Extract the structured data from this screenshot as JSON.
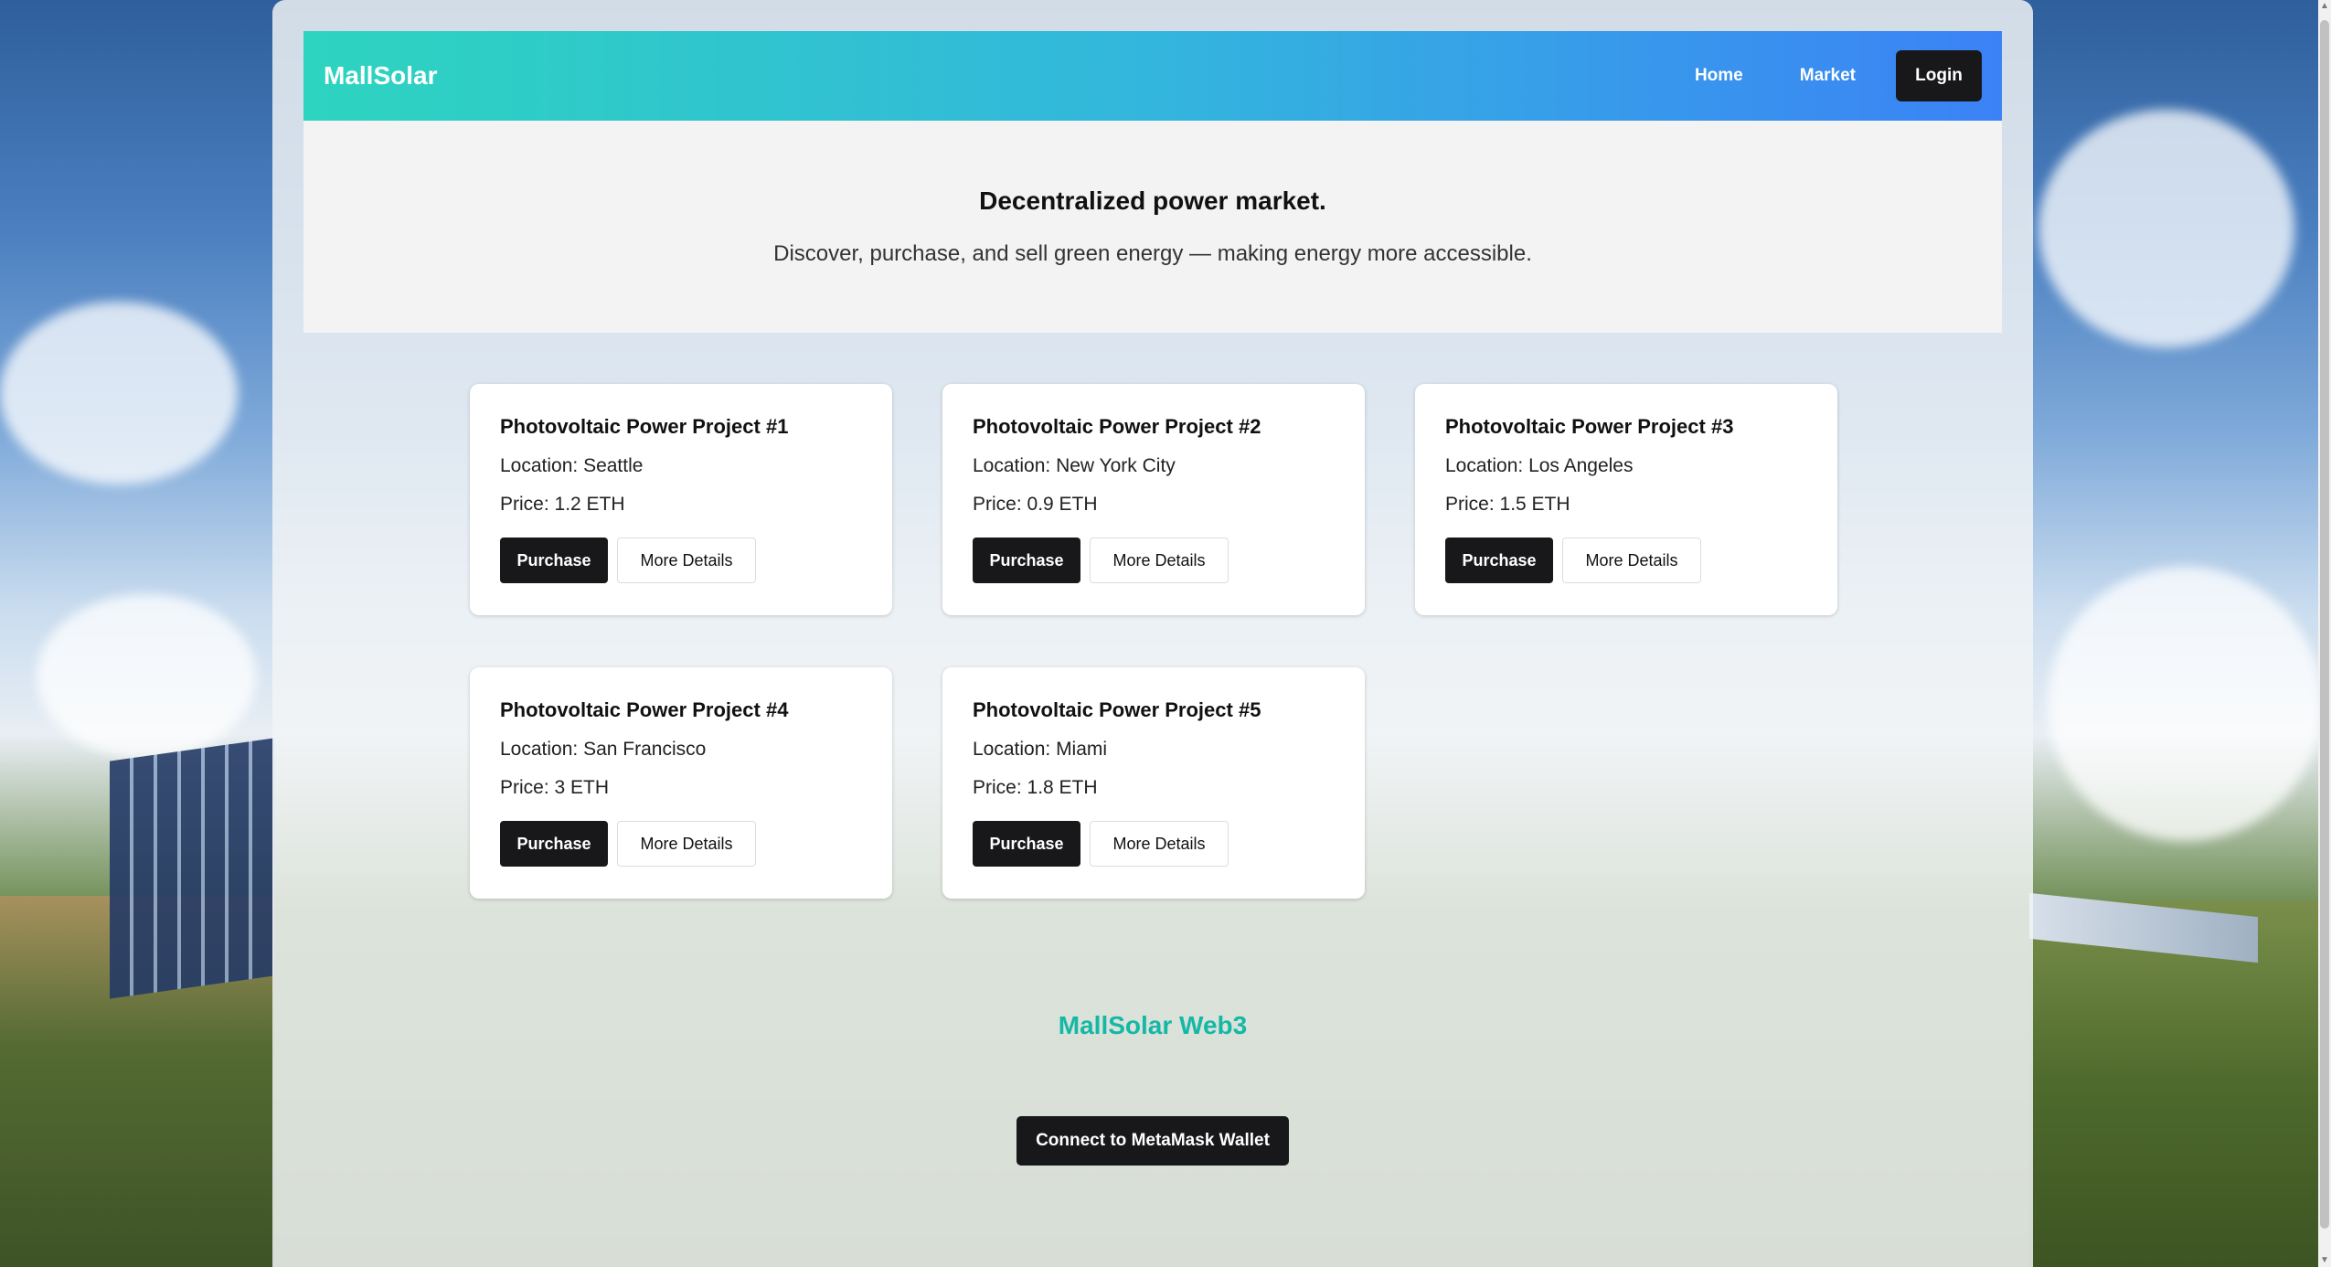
{
  "navbar": {
    "brand": "MallSolar",
    "links": [
      "Home",
      "Market"
    ],
    "login_label": "Login"
  },
  "hero": {
    "title": "Decentralized power market.",
    "subtitle": "Discover, purchase, and sell green energy — making energy more accessible."
  },
  "projects": [
    {
      "title": "Photovoltaic Power Project #1",
      "location": "Location: Seattle",
      "price": "Price: 1.2 ETH",
      "purchase_label": "Purchase",
      "details_label": "More Details"
    },
    {
      "title": "Photovoltaic Power Project #2",
      "location": "Location: New York City",
      "price": "Price: 0.9 ETH",
      "purchase_label": "Purchase",
      "details_label": "More Details"
    },
    {
      "title": "Photovoltaic Power Project #3",
      "location": "Location: Los Angeles",
      "price": "Price: 1.5 ETH",
      "purchase_label": "Purchase",
      "details_label": "More Details"
    },
    {
      "title": "Photovoltaic Power Project #4",
      "location": "Location: San Francisco",
      "price": "Price: 3 ETH",
      "purchase_label": "Purchase",
      "details_label": "More Details"
    },
    {
      "title": "Photovoltaic Power Project #5",
      "location": "Location: Miami",
      "price": "Price: 1.8 ETH",
      "purchase_label": "Purchase",
      "details_label": "More Details"
    }
  ],
  "footer": {
    "brand": "MallSolar Web3",
    "connect_label": "Connect to MetaMask Wallet"
  },
  "colors": {
    "accent": "#14b8a6",
    "nav_gradient_start": "#2dd4bf",
    "nav_gradient_end": "#3b82f6",
    "button_dark": "#18181b"
  }
}
